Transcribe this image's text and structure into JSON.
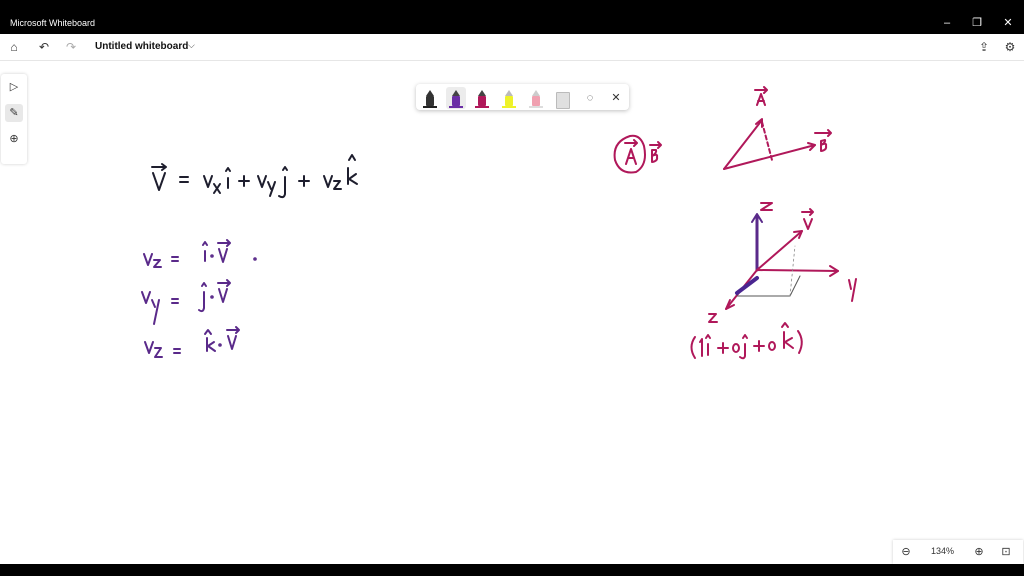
{
  "window": {
    "title": "Microsoft Whiteboard",
    "minimize": "–",
    "restore": "❐",
    "close": "✕"
  },
  "appbar": {
    "doc_title": "Untitled whiteboard",
    "home_icon": "home-icon",
    "undo_icon": "undo-icon",
    "redo_icon": "redo-icon",
    "share_icon": "share-icon",
    "settings_icon": "gear-icon"
  },
  "pen_tray": {
    "pens": [
      {
        "name": "black-pen",
        "color": "#222222"
      },
      {
        "name": "purple-pen",
        "color": "#6b2fa6"
      },
      {
        "name": "magenta-pen",
        "color": "#b0185a"
      },
      {
        "name": "yellow-highlighter",
        "color": "#eef22a"
      },
      {
        "name": "pink-highlighter",
        "color": "#f0a0b0"
      }
    ],
    "selected": "purple-pen"
  },
  "zoom": {
    "value": "134%"
  },
  "ink_colors": {
    "purple": "#5a2a8a",
    "magenta": "#b0185a",
    "dark_purple": "#4a2590"
  }
}
